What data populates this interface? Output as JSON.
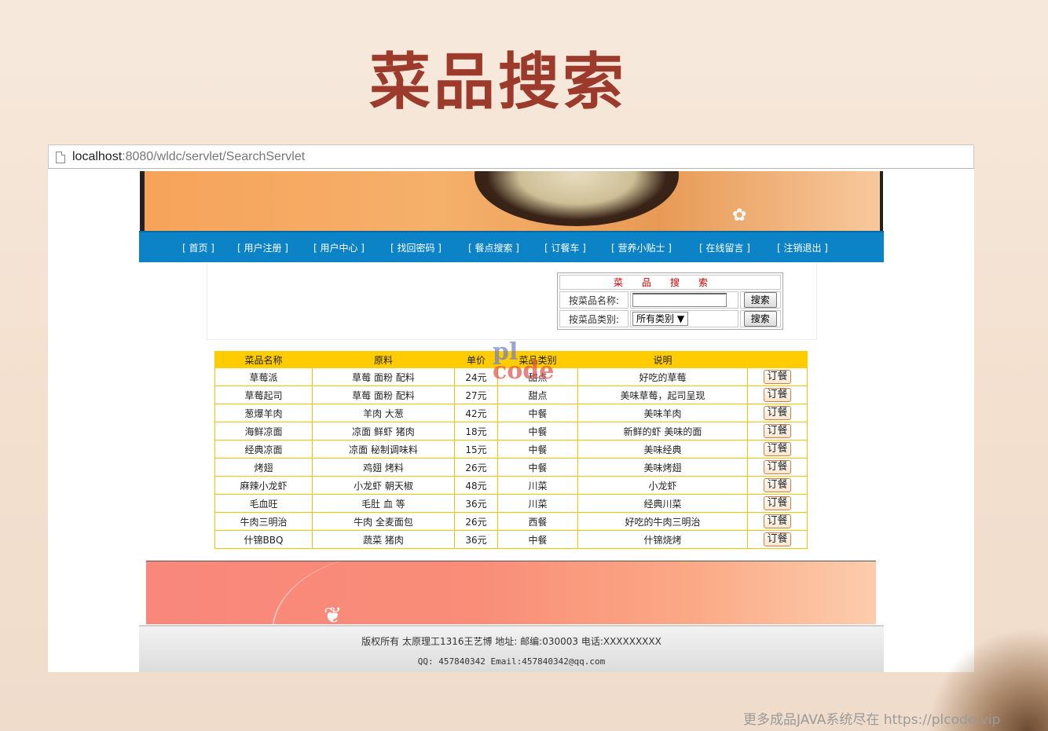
{
  "slide_title": "菜品搜索",
  "browser": {
    "url_host": "localhost",
    "url_rest": ":8080/wldc/servlet/SearchServlet"
  },
  "nav": {
    "items": [
      "[ 首页 ]",
      "[ 用户注册 ]",
      "[ 用户中心 ]",
      "[ 找回密码 ]",
      "[ 餐点搜索 ]",
      "[ 订餐车 ]",
      "[ 营养小贴士 ]",
      "[ 在线留言 ]",
      "[ 注销退出 ]"
    ]
  },
  "search": {
    "heading": "菜品搜索",
    "by_name_label": "按菜品名称:",
    "name_value": "",
    "by_type_label": "按菜品类别:",
    "type_selected": "所有类别",
    "search_button": "搜索"
  },
  "table": {
    "headers": [
      "菜品名称",
      "原料",
      "单价",
      "菜品类别",
      "说明",
      ""
    ],
    "order_label": "订餐",
    "rows": [
      {
        "name": "草莓派",
        "ingredients": "草莓 面粉 配料",
        "price": "24元",
        "type": "甜点",
        "desc": "好吃的草莓"
      },
      {
        "name": "草莓起司",
        "ingredients": "草莓 面粉 配料",
        "price": "27元",
        "type": "甜点",
        "desc": "美味草莓，起司呈现"
      },
      {
        "name": "葱爆羊肉",
        "ingredients": "羊肉 大葱",
        "price": "42元",
        "type": "中餐",
        "desc": "美味羊肉"
      },
      {
        "name": "海鲜凉面",
        "ingredients": "凉面 鲜虾 猪肉",
        "price": "18元",
        "type": "中餐",
        "desc": "新鲜的虾 美味的面"
      },
      {
        "name": "经典凉面",
        "ingredients": "凉面 秘制调味料",
        "price": "15元",
        "type": "中餐",
        "desc": "美味经典"
      },
      {
        "name": "烤翅",
        "ingredients": "鸡翅 烤料",
        "price": "26元",
        "type": "中餐",
        "desc": "美味烤翅"
      },
      {
        "name": "麻辣小龙虾",
        "ingredients": "小龙虾 朝天椒",
        "price": "48元",
        "type": "川菜",
        "desc": "小龙虾"
      },
      {
        "name": "毛血旺",
        "ingredients": "毛肚 血 等",
        "price": "36元",
        "type": "川菜",
        "desc": "经典川菜"
      },
      {
        "name": "牛肉三明治",
        "ingredients": "牛肉 全麦面包",
        "price": "26元",
        "type": "西餐",
        "desc": "好吃的牛肉三明治"
      },
      {
        "name": "什锦BBQ",
        "ingredients": "蔬菜 猪肉",
        "price": "36元",
        "type": "中餐",
        "desc": "什锦烧烤"
      }
    ]
  },
  "watermark": {
    "line1": "pl",
    "line2": "code"
  },
  "footer": {
    "line1": "版权所有 太原理工1316王艺博 地址: 邮编:030003 电话:XXXXXXXXX",
    "line2": "QQ: 457840342    Email:457840342@qq.com"
  },
  "credit": "更多成品JAVA系统尽在 https://plcode.vip"
}
